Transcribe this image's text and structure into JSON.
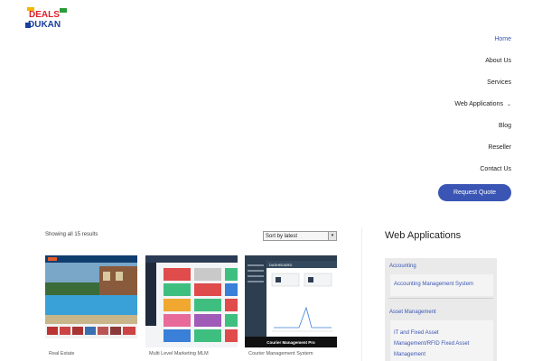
{
  "brand": {
    "logo_top": "DEALS",
    "logo_bottom": "DUKAN"
  },
  "nav": {
    "items": [
      {
        "label": "Home",
        "active": true
      },
      {
        "label": "About Us"
      },
      {
        "label": "Services"
      },
      {
        "label": "Web Applications",
        "has_dropdown": true
      },
      {
        "label": "Blog"
      },
      {
        "label": "Reseller"
      },
      {
        "label": "Contact Us"
      }
    ],
    "cta": "Request Quote"
  },
  "shop": {
    "results_text": "Showing all 15 results",
    "sort_value": "Sort by latest",
    "products": [
      {
        "title": "Real Estate"
      },
      {
        "title": "Multi Level Marketing MLM"
      },
      {
        "title": "Courier Management System",
        "thumb_banner": "Courier Management Pro",
        "thumb_header": "DASHBOARD"
      }
    ]
  },
  "sidebar": {
    "title": "Web Applications",
    "categories": [
      {
        "label": "Accounting",
        "children": [
          "Accounting Management System"
        ]
      },
      {
        "label": "Asset Management",
        "children": [
          "IT and Fixed Asset Management/RFID Fixed Asset Management"
        ]
      }
    ]
  },
  "colors": {
    "accent": "#3a55b4",
    "logo_red": "#e0202a",
    "logo_blue": "#1b3f9c"
  }
}
